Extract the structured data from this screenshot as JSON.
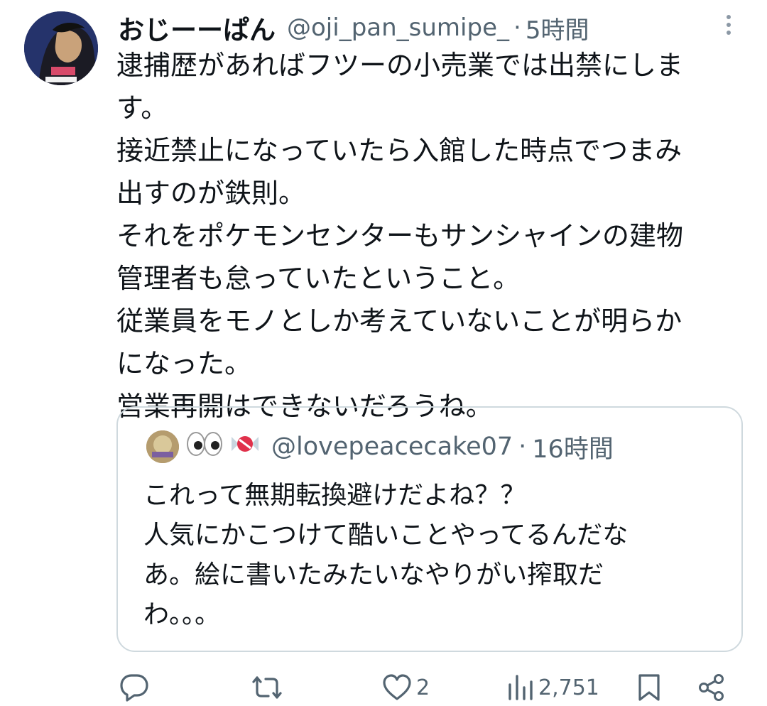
{
  "tweet": {
    "author_name": "おじーーぱん",
    "handle": "@oji_pan_sumipe_",
    "separator": "·",
    "time": "5時間",
    "text_lines": [
      "逮捕歴があればフツーの小売業では出禁にしま",
      "す。",
      "接近禁止になっていたら入館した時点でつまみ",
      "出すのが鉄則。",
      "それをポケモンセンターもサンシャインの建物",
      "管理者も怠っていたということ。",
      "従業員をモノとしか考えていないことが明らか",
      "になった。",
      "営業再開はできないだろうね。"
    ]
  },
  "quote": {
    "display_emoji": "👀🍬",
    "handle": "@lovepeacecake07",
    "separator": "·",
    "time": "16時間",
    "text_lines": [
      "これって無期転換避けだよね？？",
      "人気にかこつけて酷いことやってるんだな",
      "あ。絵に書いたみたいなやりがい搾取だ",
      "わ。。。"
    ]
  },
  "actions": {
    "reply_count": "",
    "retweet_count": "",
    "like_count": "2",
    "views_count": "2,751"
  },
  "colors": {
    "text": "#0f1419",
    "secondary": "#536471",
    "border": "#cfd9de"
  }
}
